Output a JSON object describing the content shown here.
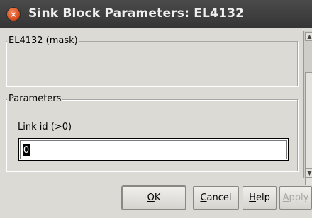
{
  "window": {
    "title": "Sink Block Parameters: EL4132",
    "close_glyph": "×"
  },
  "mask_group": {
    "legend": "EL4132 (mask)"
  },
  "params_group": {
    "legend": "Parameters",
    "link_id_label": "Link id (>0)",
    "link_id_value": "0"
  },
  "buttons": {
    "ok": {
      "mnemonic": "O",
      "rest": "K"
    },
    "cancel": {
      "mnemonic": "C",
      "rest": "ancel"
    },
    "help": {
      "mnemonic": "H",
      "rest": "elp"
    },
    "apply": {
      "mnemonic": "A",
      "rest": "pply"
    }
  },
  "icons": {
    "close": "close-icon",
    "scroll_up": "arrow-up-icon",
    "scroll_down": "arrow-down-icon"
  },
  "colors": {
    "titlebar": "#3d3d3d",
    "close_button": "#e0602c",
    "window_bg": "#dcdad5"
  }
}
